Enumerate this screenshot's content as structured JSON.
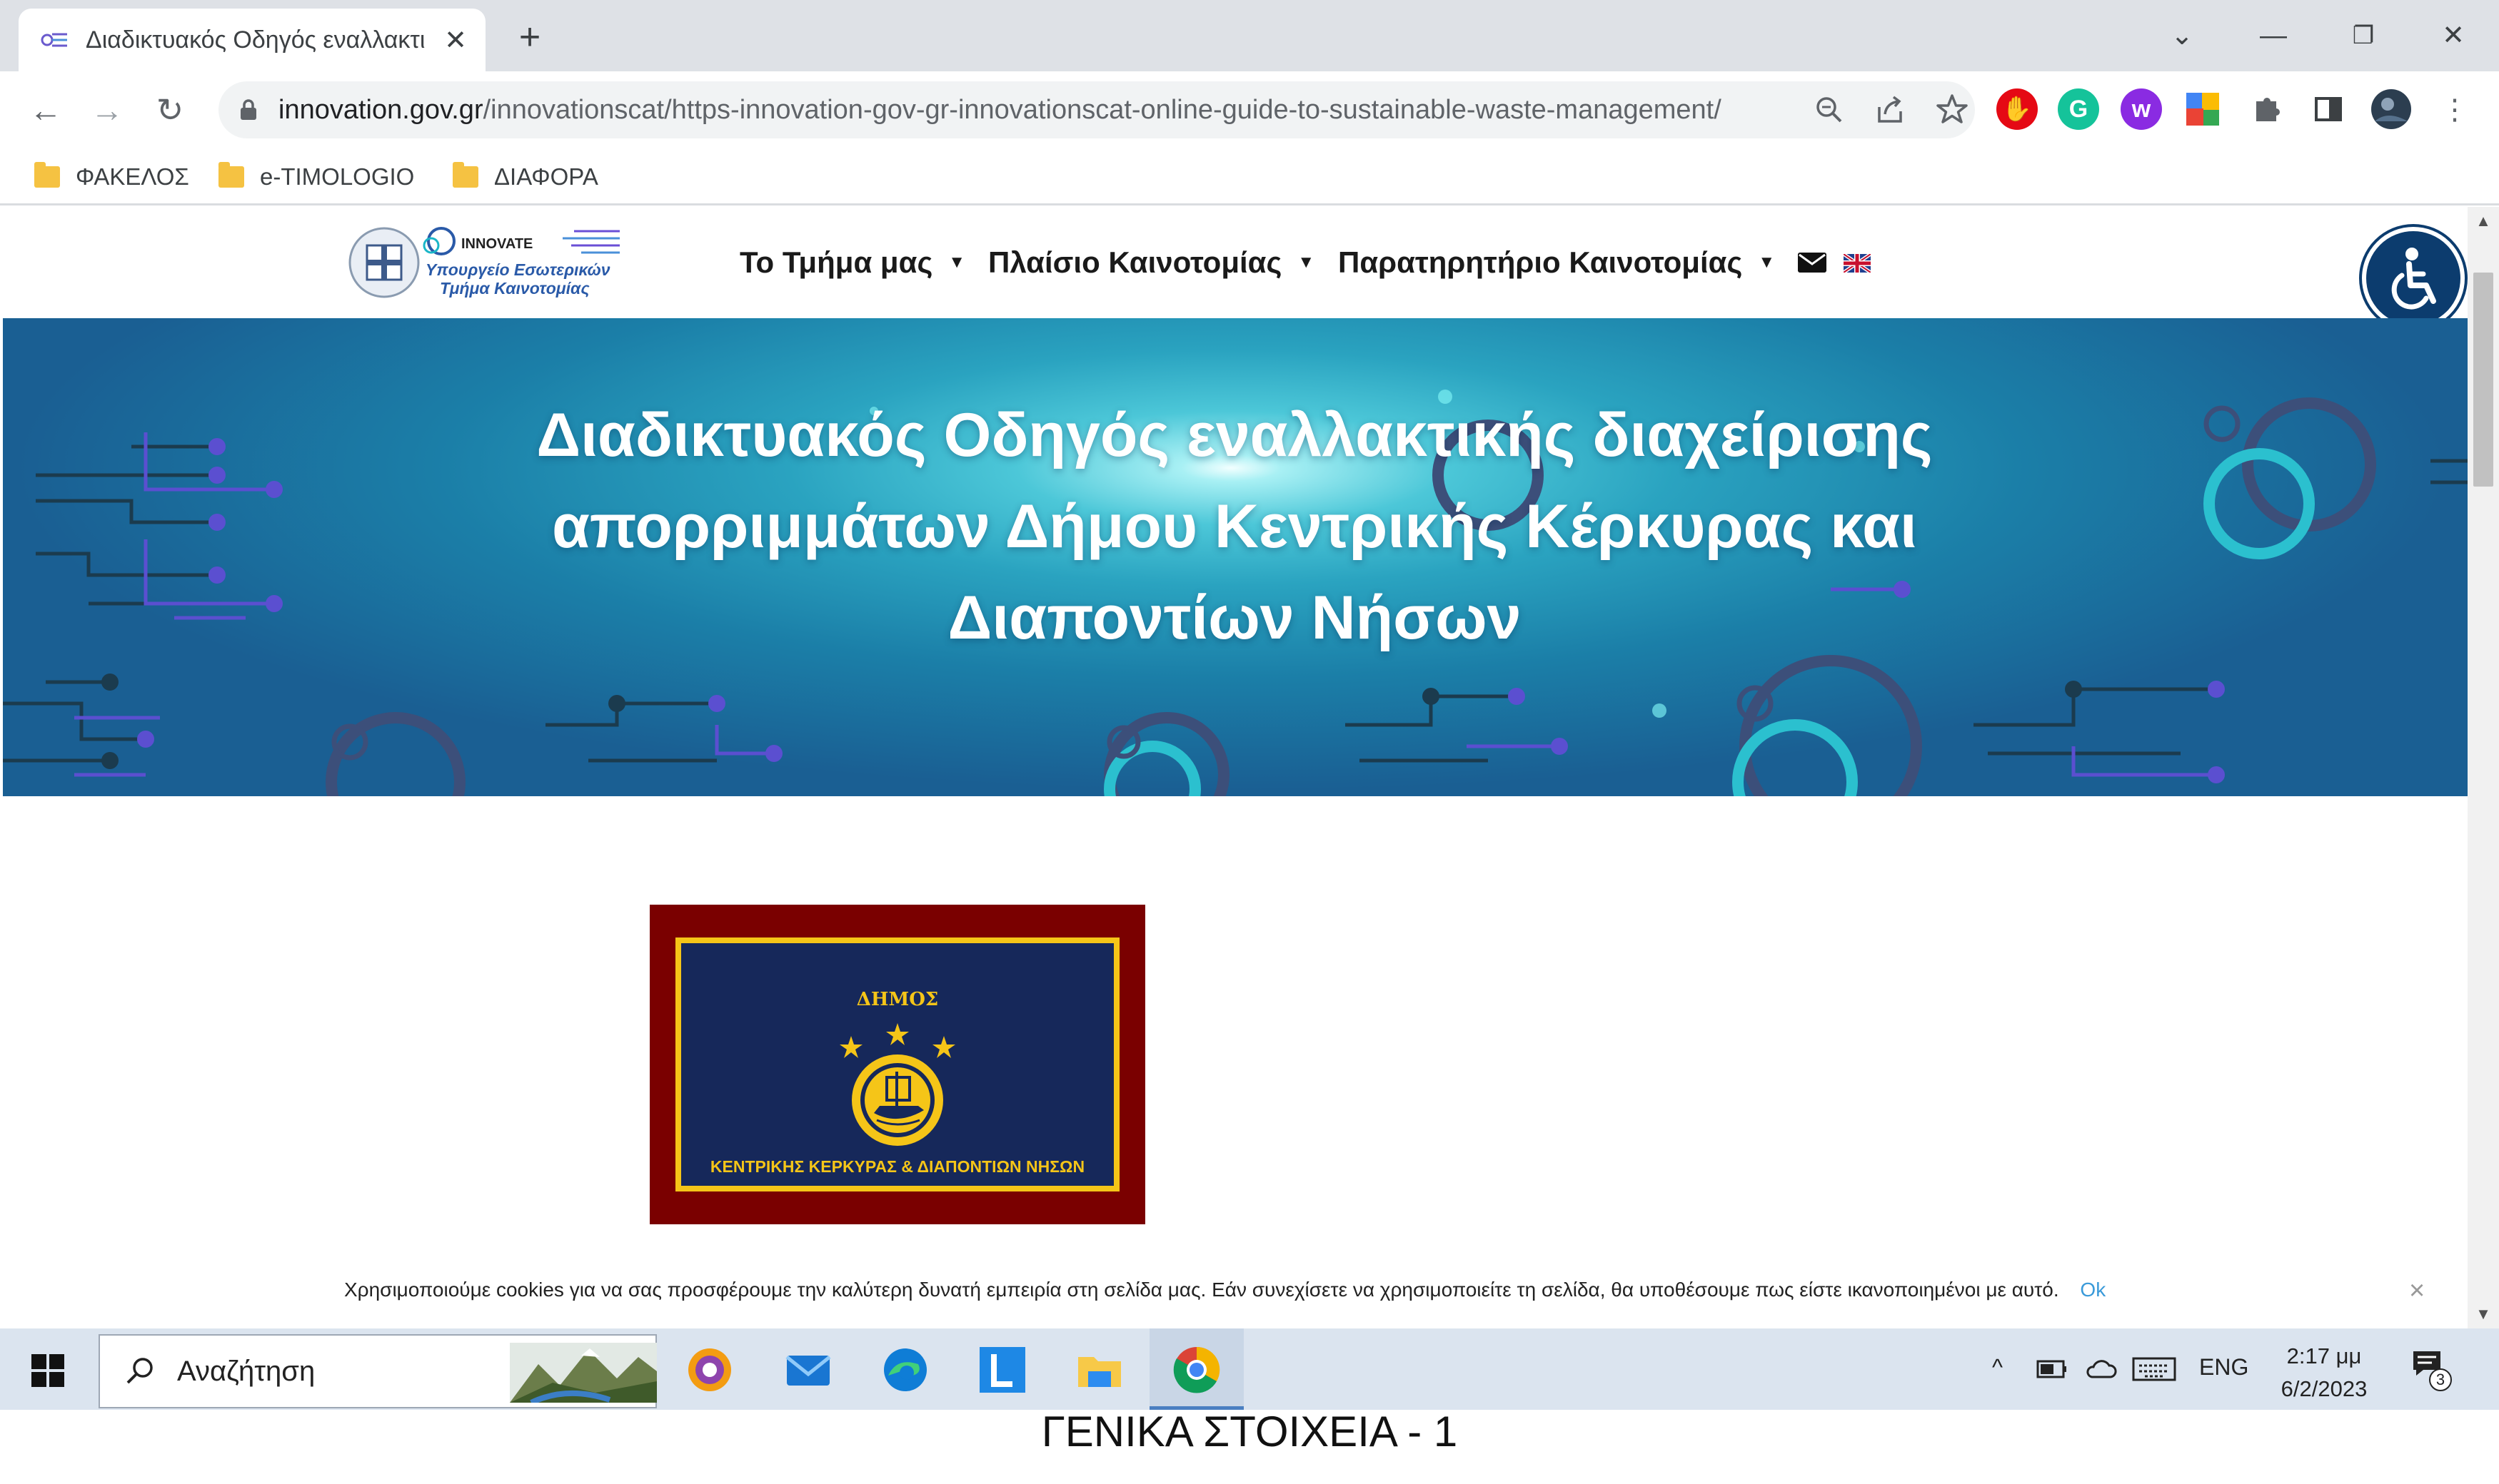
{
  "browser": {
    "tab": {
      "title": "Διαδικτυακός Οδηγός εναλλακτι",
      "close_glyph": "✕"
    },
    "new_tab_glyph": "+",
    "window": {
      "tabsearch_glyph": "⌄",
      "minimize_glyph": "—",
      "restore_glyph": "❐",
      "close_glyph": "✕"
    },
    "nav": {
      "back_glyph": "←",
      "forward_glyph": "→",
      "reload_glyph": "↻"
    },
    "url": {
      "host": "innovation.gov.gr",
      "path": "/innovationscat/https-innovation-gov-gr-innovationscat-online-guide-to-sustainable-waste-management/"
    },
    "bookmarks": [
      "ΦΑΚΕΛΟΣ",
      "e-TIMOLOGIO",
      "ΔΙΑΦΟΡΑ"
    ]
  },
  "site": {
    "logo": {
      "brand": "INNOVATE",
      "line1": "Υπουργείο Εσωτερικών",
      "line2": "Τμήμα Καινοτομίας"
    },
    "menu": [
      "Το Τμήμα μας",
      "Πλαίσιο Καινοτομίας",
      "Παρατηρητήριο Καινοτομίας"
    ],
    "caret": "▼",
    "hero_title_lines": [
      "Διαδικτυακός Οδηγός εναλλακτικής διαχείρισης",
      "απορριμμάτων Δήμου Κεντρικής Κέρκυρας και",
      "Διαποντίων Νήσων"
    ],
    "emblem": {
      "top": "ΔΗΜΟΣ",
      "bottom": "ΚΕΝΤΡΙΚΗΣ ΚΕΡΚΥΡΑΣ & ΔΙΑΠΟΝΤΙΩΝ ΝΗΣΩΝ"
    },
    "cookie": {
      "text": "Χρησιμοποιούμε cookies για να σας προσφέρουμε την καλύτερη δυνατή εμπειρία στη σελίδα μας. Εάν συνεχίσετε να χρησιμοποιείτε τη σελίδα, θα υποθέσουμε πως είστε ικανοποιημένοι με αυτό.",
      "ok": "Ok",
      "close": "×"
    }
  },
  "taskbar": {
    "search": "Αναζήτηση",
    "language": "ENG",
    "time": "2:17 μμ",
    "date": "6/2/2023",
    "notifications": "3",
    "tray_chevron": "^"
  },
  "caption": "ΓΕΝΙΚΑ ΣΤΟΙΧΕΙΑ - 1"
}
